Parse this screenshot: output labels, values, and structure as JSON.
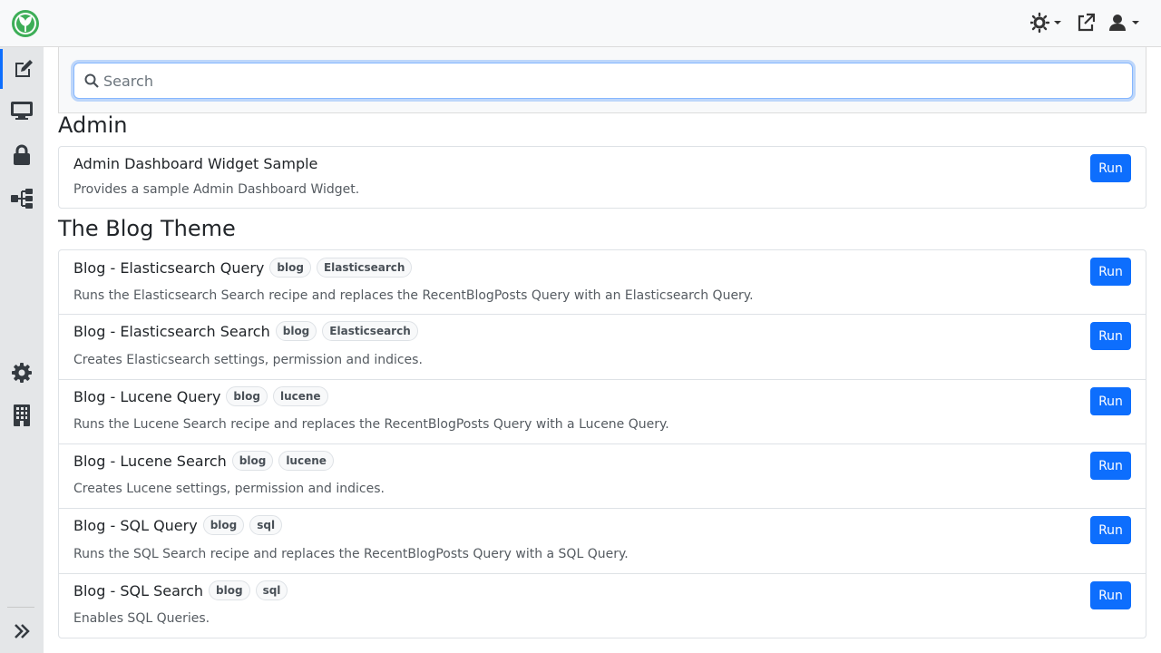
{
  "search": {
    "placeholder": "Search"
  },
  "sections": [
    {
      "title": "Admin",
      "items": [
        {
          "title": "Admin Dashboard Widget Sample",
          "tags": [],
          "description": "Provides a sample Admin Dashboard Widget.",
          "action": "Run"
        }
      ]
    },
    {
      "title": "The Blog Theme",
      "items": [
        {
          "title": "Blog - Elasticsearch Query",
          "tags": [
            "blog",
            "Elasticsearch"
          ],
          "description": "Runs the Elasticsearch Search recipe and replaces the RecentBlogPosts Query with an Elasticsearch Query.",
          "action": "Run"
        },
        {
          "title": "Blog - Elasticsearch Search",
          "tags": [
            "blog",
            "Elasticsearch"
          ],
          "description": "Creates Elasticsearch settings, permission and indices.",
          "action": "Run"
        },
        {
          "title": "Blog - Lucene Query",
          "tags": [
            "blog",
            "lucene"
          ],
          "description": "Runs the Lucene Search recipe and replaces the RecentBlogPosts Query with a Lucene Query.",
          "action": "Run"
        },
        {
          "title": "Blog - Lucene Search",
          "tags": [
            "blog",
            "lucene"
          ],
          "description": "Creates Lucene settings, permission and indices.",
          "action": "Run"
        },
        {
          "title": "Blog - SQL Query",
          "tags": [
            "blog",
            "sql"
          ],
          "description": "Runs the SQL Search recipe and replaces the RecentBlogPosts Query with a SQL Query.",
          "action": "Run"
        },
        {
          "title": "Blog - SQL Search",
          "tags": [
            "blog",
            "sql"
          ],
          "description": "Enables SQL Queries.",
          "action": "Run"
        }
      ]
    }
  ],
  "colors": {
    "accent": "#0d6efd",
    "logo": "#3dae57",
    "sidebar": "#e4e6e8"
  },
  "icons": {
    "topbar": [
      "theme-toggle-icon",
      "external-link-icon",
      "user-icon"
    ],
    "sidebar": [
      "edit-icon",
      "desktop-icon",
      "lock-icon",
      "sitemap-icon",
      "gear-icon",
      "building-icon",
      "expand-sidebar-icon"
    ]
  }
}
